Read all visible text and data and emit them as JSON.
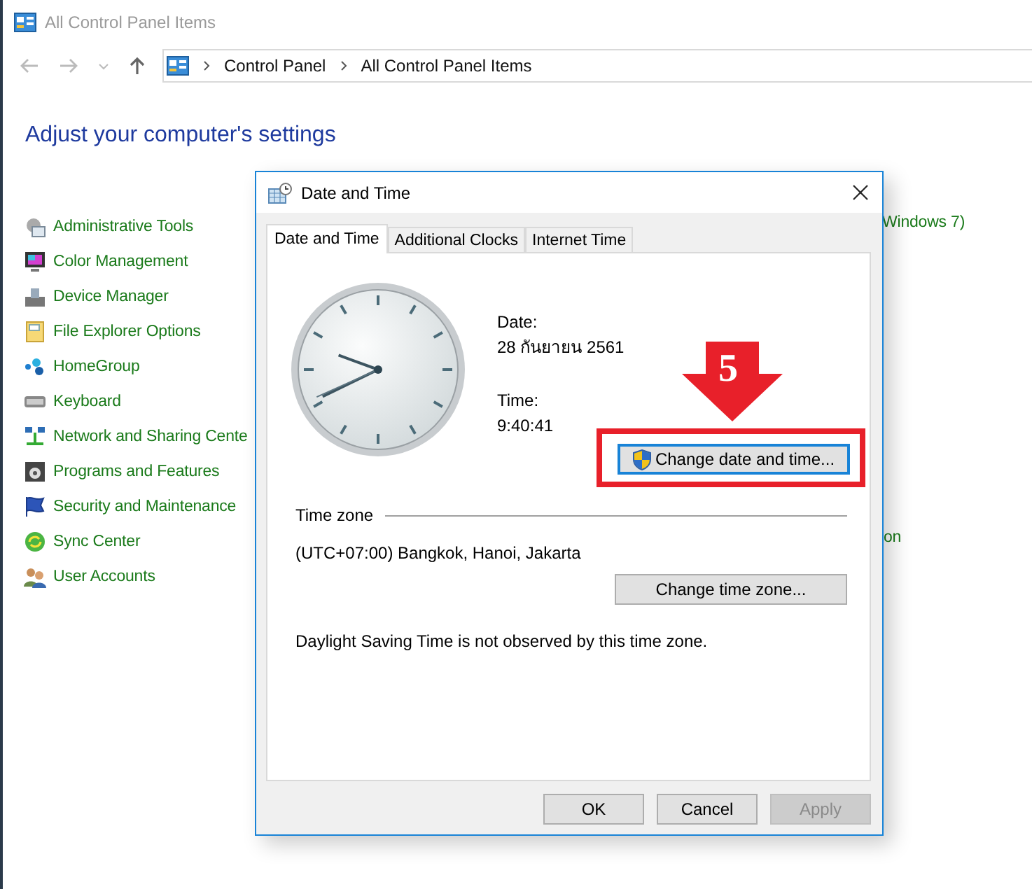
{
  "window": {
    "title": "All Control Panel Items"
  },
  "address_bar": {
    "path": [
      "Control Panel",
      "All Control Panel Items"
    ]
  },
  "heading": "Adjust your computer's settings",
  "items_left": [
    {
      "label": "Administrative Tools"
    },
    {
      "label": "Color Management"
    },
    {
      "label": "Device Manager"
    },
    {
      "label": "File Explorer Options"
    },
    {
      "label": "HomeGroup"
    },
    {
      "label": "Keyboard"
    },
    {
      "label": "Network and Sharing Cente"
    },
    {
      "label": "Programs and Features"
    },
    {
      "label": "Security and Maintenance"
    },
    {
      "label": "Sync Center"
    },
    {
      "label": "User Accounts"
    }
  ],
  "items_right": [
    {
      "label": "Windows 7)"
    },
    {
      "label": "on"
    }
  ],
  "dialog": {
    "title": "Date and Time",
    "tabs": [
      {
        "label": "Date and Time",
        "selected": true
      },
      {
        "label": "Additional Clocks",
        "selected": false
      },
      {
        "label": "Internet Time",
        "selected": false
      }
    ],
    "date_label": "Date:",
    "date": "28 กันยายน 2561",
    "time_label": "Time:",
    "time": "9:40:41",
    "change_date_button": "Change date and time...",
    "time_zone_heading": "Time zone",
    "time_zone": "(UTC+07:00) Bangkok, Hanoi, Jakarta",
    "change_time_zone_button": "Change time zone...",
    "dst_note": "Daylight Saving Time is not observed by this time zone.",
    "buttons": [
      {
        "label": "OK",
        "disabled": false
      },
      {
        "label": "Cancel",
        "disabled": false
      },
      {
        "label": "Apply",
        "disabled": true
      }
    ]
  },
  "annotation": {
    "step": "5"
  }
}
